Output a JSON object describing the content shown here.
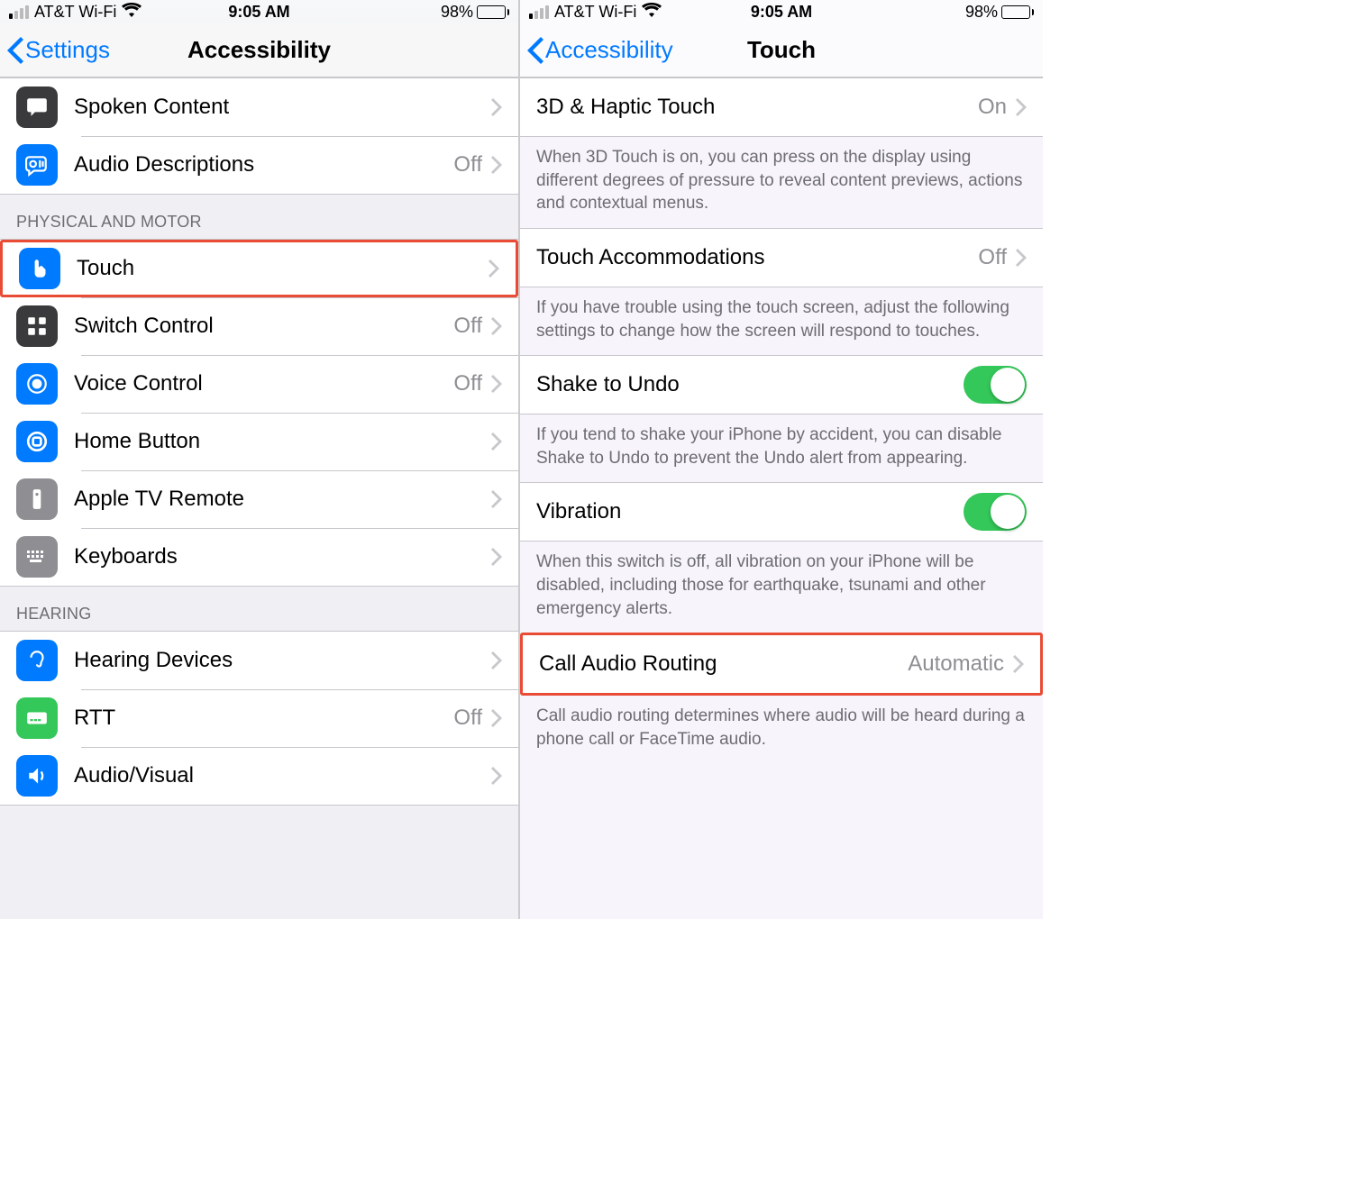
{
  "statusbar": {
    "carrier": "AT&T Wi-Fi",
    "time": "9:05 AM",
    "battery_pct": "98%"
  },
  "left": {
    "back_label": "Settings",
    "title": "Accessibility",
    "rows": {
      "spoken_content": "Spoken Content",
      "audio_descriptions": "Audio Descriptions",
      "audio_descriptions_val": "Off",
      "touch": "Touch",
      "switch_control": "Switch Control",
      "switch_control_val": "Off",
      "voice_control": "Voice Control",
      "voice_control_val": "Off",
      "home_button": "Home Button",
      "apple_tv_remote": "Apple TV Remote",
      "keyboards": "Keyboards",
      "hearing_devices": "Hearing Devices",
      "rtt": "RTT",
      "rtt_val": "Off",
      "audio_visual": "Audio/Visual"
    },
    "headers": {
      "physical_motor": "Physical and Motor",
      "hearing": "Hearing"
    }
  },
  "right": {
    "back_label": "Accessibility",
    "title": "Touch",
    "rows": {
      "haptic": "3D & Haptic Touch",
      "haptic_val": "On",
      "accommodations": "Touch Accommodations",
      "accommodations_val": "Off",
      "shake": "Shake to Undo",
      "vibration": "Vibration",
      "call_routing": "Call Audio Routing",
      "call_routing_val": "Automatic"
    },
    "footers": {
      "haptic": "When 3D Touch is on, you can press on the display using different degrees of pressure to reveal content previews, actions and contextual menus.",
      "accommodations": "If you have trouble using the touch screen, adjust the following settings to change how the screen will respond to touches.",
      "shake": "If you tend to shake your iPhone by accident, you can disable Shake to Undo to prevent the Undo alert from appearing.",
      "vibration": "When this switch is off, all vibration on your iPhone will be disabled, including those for earthquake, tsunami and other emergency alerts.",
      "call_routing": "Call audio routing determines where audio will be heard during a phone call or FaceTime audio."
    }
  }
}
